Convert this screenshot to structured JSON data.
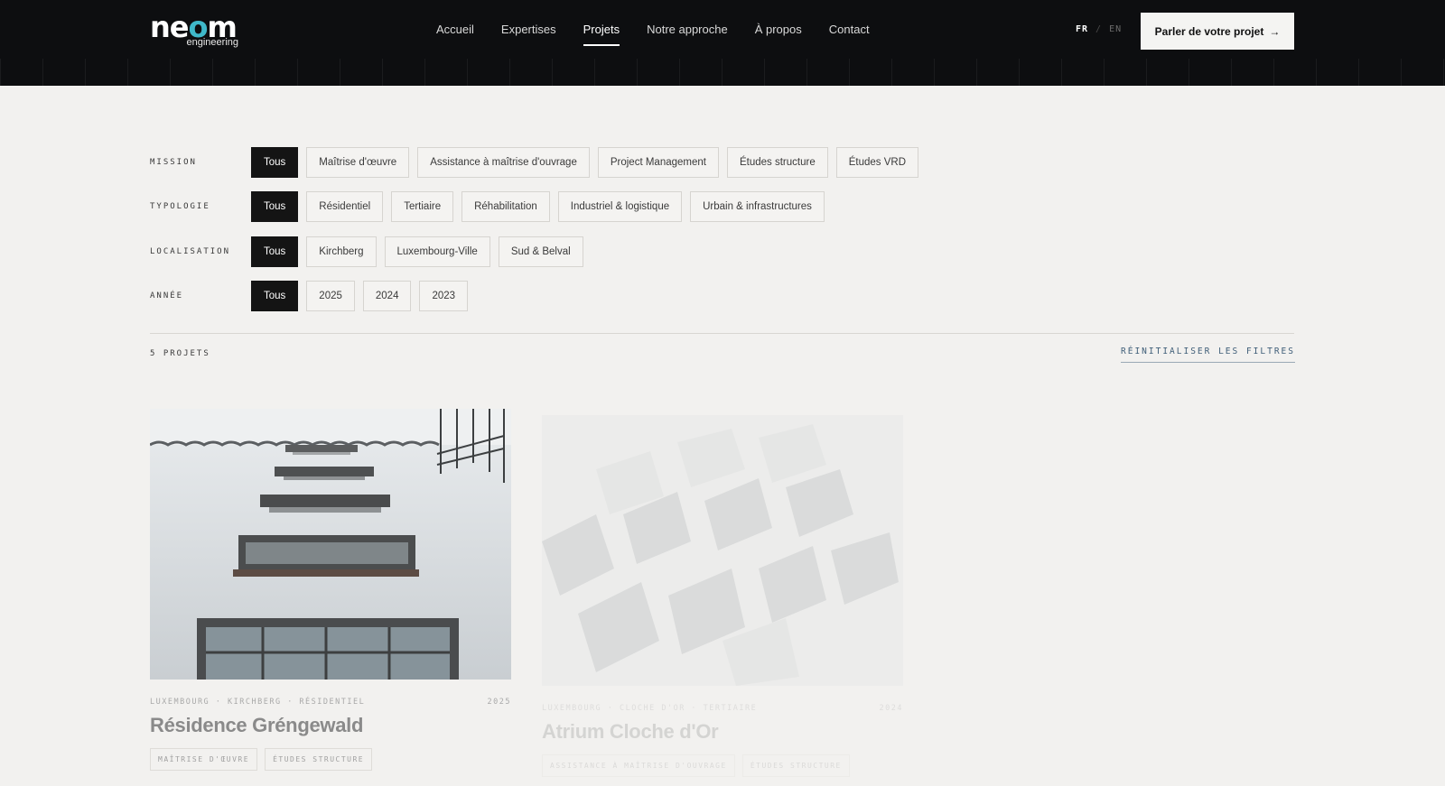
{
  "header": {
    "logo_main_1": "ne",
    "logo_main_accent": "o",
    "logo_main_2": "m",
    "logo_sub": "engineering",
    "nav": [
      {
        "label": "Accueil",
        "active": false
      },
      {
        "label": "Expertises",
        "active": false
      },
      {
        "label": "Projets",
        "active": true
      },
      {
        "label": "Notre approche",
        "active": false
      },
      {
        "label": "À propos",
        "active": false
      },
      {
        "label": "Contact",
        "active": false
      }
    ],
    "lang_fr": "FR",
    "lang_sep": "/",
    "lang_en": "EN",
    "cta_label": "Parler de votre projet",
    "cta_arrow": "→"
  },
  "filters": {
    "mission": {
      "label": "MISSION",
      "options": [
        "Tous",
        "Maîtrise d'œuvre",
        "Assistance à maîtrise d'ouvrage",
        "Project Management",
        "Études structure",
        "Études VRD"
      ],
      "selected": "Tous"
    },
    "typologie": {
      "label": "TYPOLOGIE",
      "options": [
        "Tous",
        "Résidentiel",
        "Tertiaire",
        "Réhabilitation",
        "Industriel & logistique",
        "Urbain & infrastructures"
      ],
      "selected": "Tous"
    },
    "localisation": {
      "label": "LOCALISATION",
      "options": [
        "Tous",
        "Kirchberg",
        "Luxembourg-Ville",
        "Sud & Belval"
      ],
      "selected": "Tous"
    },
    "annee": {
      "label": "ANNÉE",
      "options": [
        "Tous",
        "2025",
        "2024",
        "2023"
      ],
      "selected": "Tous"
    }
  },
  "results": {
    "count": "5 PROJETS",
    "reset_label": "RÉINITIALISER LES FILTRES"
  },
  "projects": [
    {
      "meta": "LUXEMBOURG · KIRCHBERG · RÉSIDENTIEL",
      "year": "2025",
      "title": "Résidence Gréngewald",
      "tags": [
        "MAÎTRISE D'ŒUVRE",
        "ÉTUDES STRUCTURE"
      ]
    },
    {
      "meta": "LUXEMBOURG · CLOCHE D'OR · TERTIAIRE",
      "year": "2024",
      "title": "Atrium Cloche d'Or",
      "tags": [
        "ASSISTANCE À MAÎTRISE D'OUVRAGE",
        "ÉTUDES STRUCTURE"
      ]
    }
  ],
  "colors": {
    "header_bg": "#0d0e10",
    "page_bg": "#f2f1ef",
    "accent": "#3fb8c9",
    "chip_active": "#141414",
    "reset_link": "#3f5e78"
  }
}
